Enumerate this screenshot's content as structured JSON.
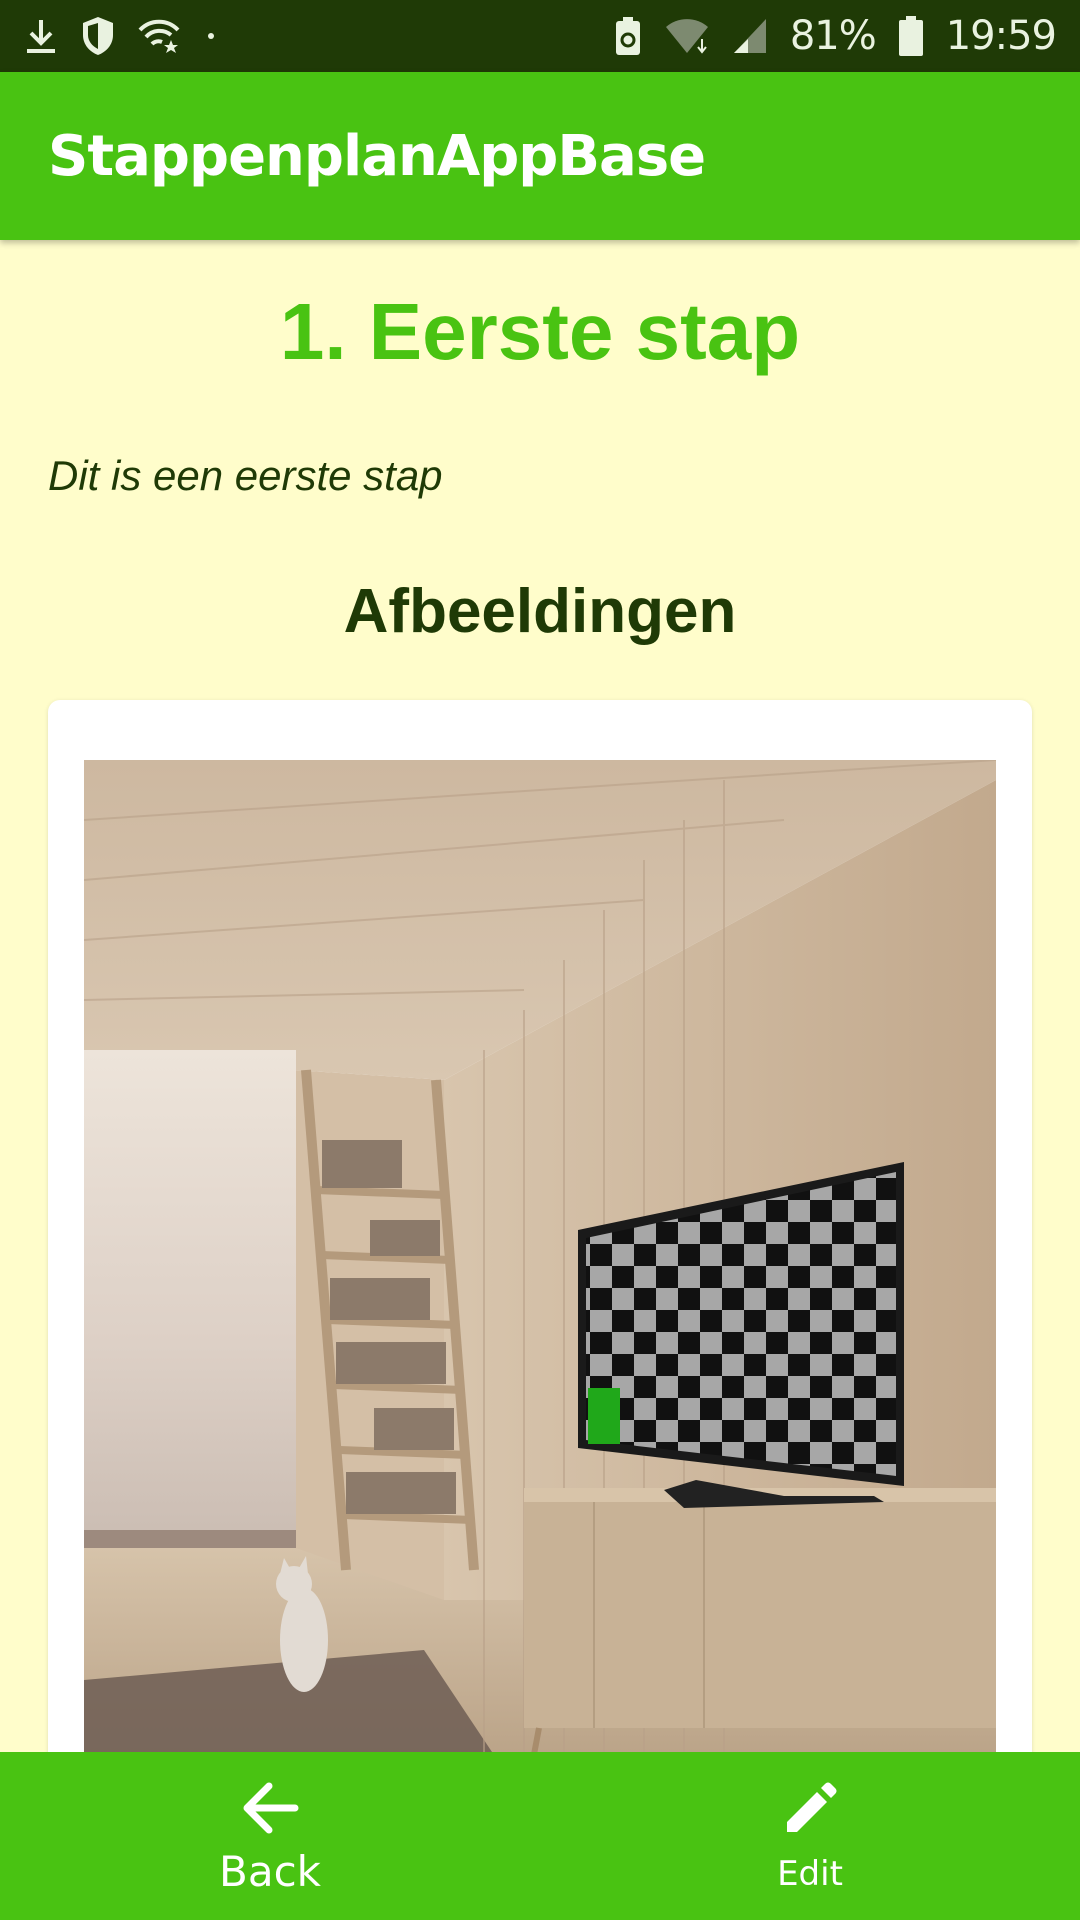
{
  "status_bar": {
    "battery_percent": "81%",
    "time": "19:59",
    "left_icons": [
      "download-icon",
      "shield-icon",
      "wifi-star-icon",
      "dot-icon"
    ],
    "right_icons": [
      "recycle-battery-icon",
      "wifi-icon",
      "signal-icon",
      "battery-icon"
    ]
  },
  "app_bar": {
    "title": "StappenplanAppBase"
  },
  "step": {
    "title": "1. Eerste stap",
    "description": "Dit is een eerste stap"
  },
  "images_section": {
    "title": "Afbeeldingen"
  },
  "bottom_bar": {
    "back_label": "Back",
    "edit_label": "Edit",
    "back_icon": "arrow-left-icon",
    "edit_icon": "pencil-icon"
  },
  "colors": {
    "accent_green": "#49c312",
    "dark_green": "#1f3a06",
    "background": "#fffdcb"
  }
}
